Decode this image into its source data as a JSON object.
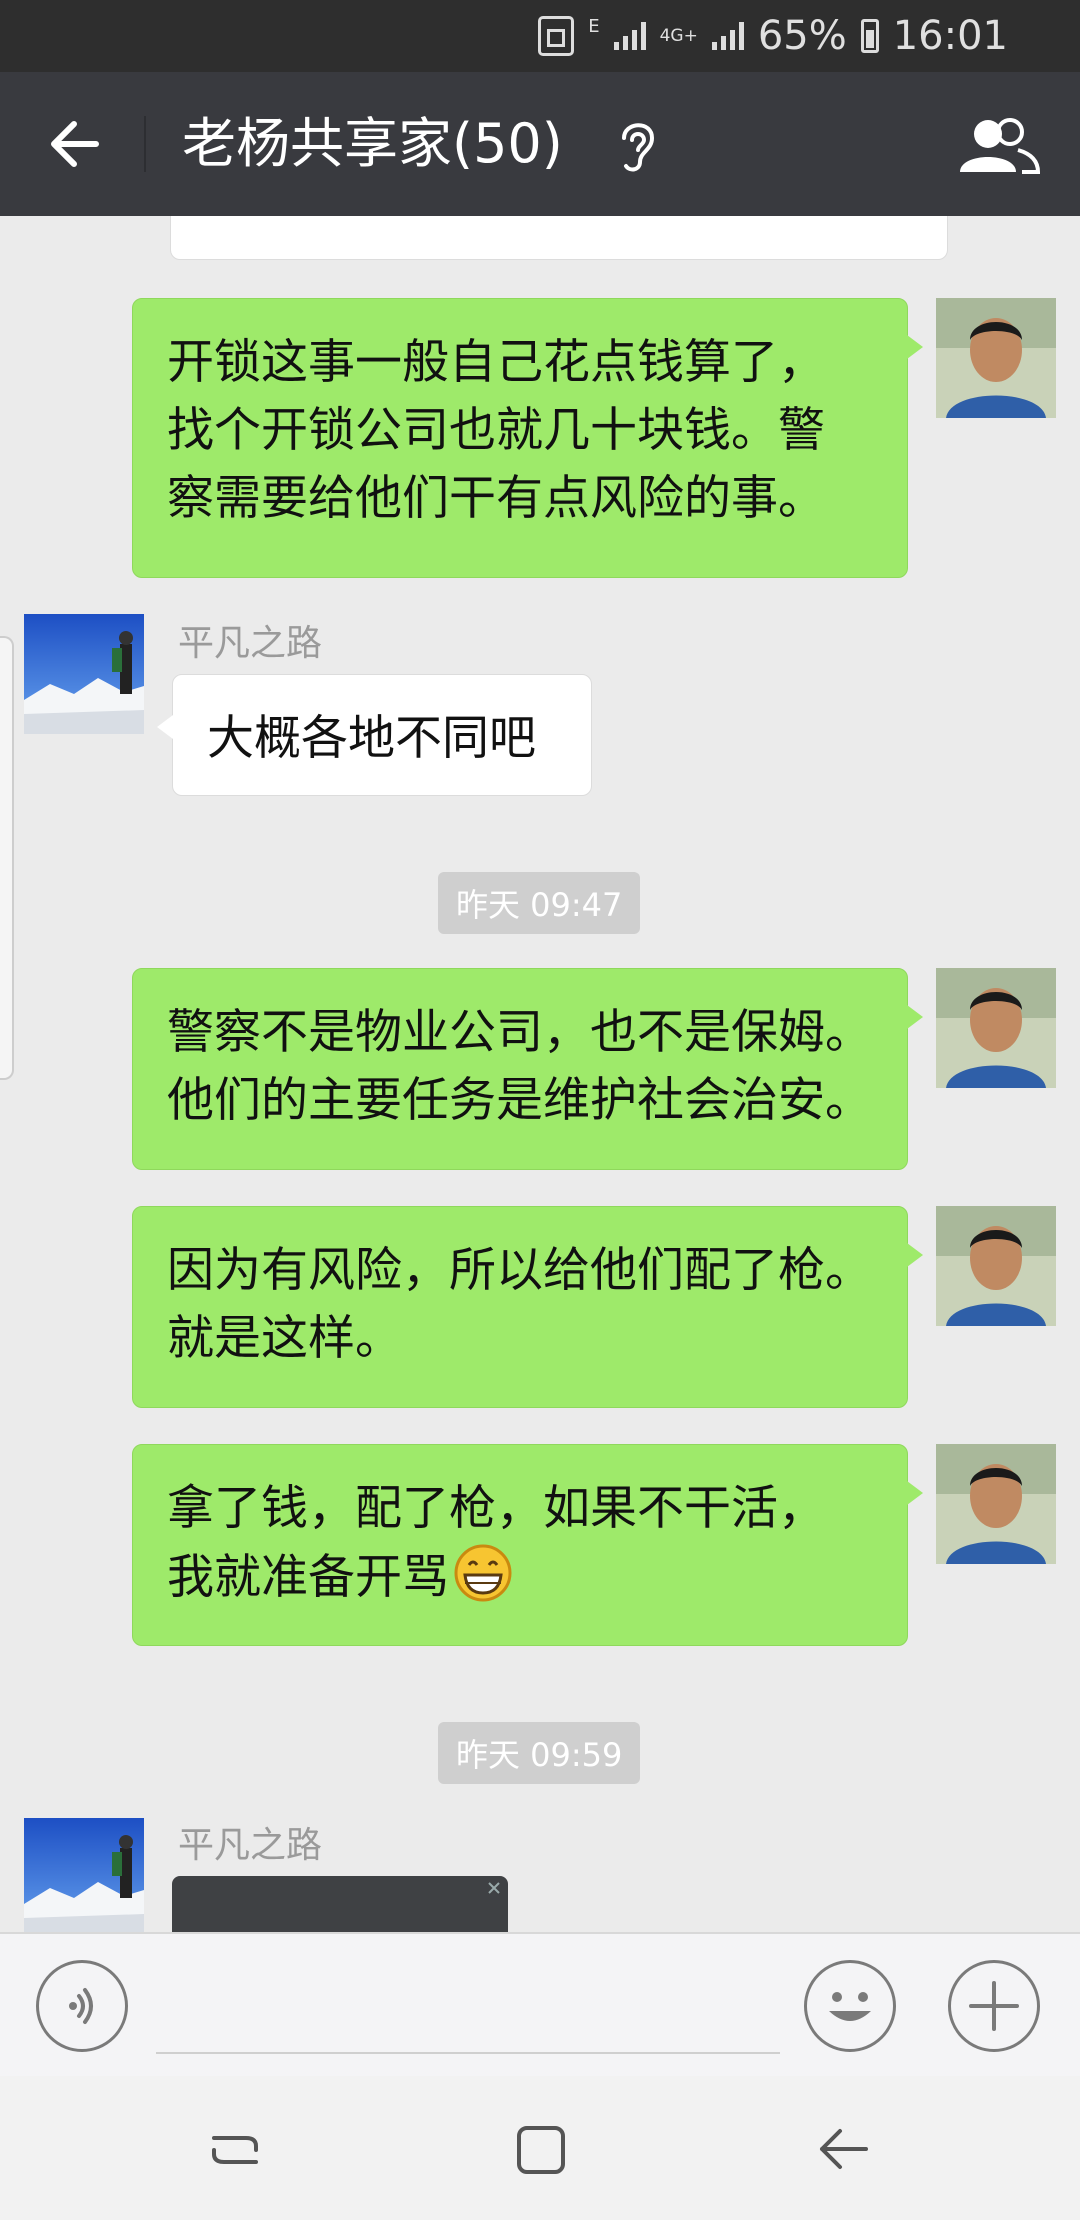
{
  "status_bar": {
    "lte_indicator": "E",
    "network_type": "4G+",
    "battery": "65%",
    "time": "16:01"
  },
  "header": {
    "title": "老杨共享家(50)",
    "icons": [
      "back-arrow-icon",
      "ear-icon",
      "group-members-icon"
    ]
  },
  "messages": [
    {
      "side": "left",
      "lines": [
        "…"
      ],
      "partial": true
    },
    {
      "side": "right",
      "lines": [
        "开锁这事一般自己花点钱算了，",
        "找个开锁公司也就几十块钱。警",
        "察需要给他们干有点风险的事。"
      ]
    },
    {
      "side": "left",
      "sender": "平凡之路",
      "lines": [
        "大概各地不同吧"
      ]
    },
    {
      "type": "time",
      "text": "昨天 09:47"
    },
    {
      "side": "right",
      "lines": [
        "警察不是物业公司，也不是保姆。",
        "他们的主要任务是维护社会治安。"
      ]
    },
    {
      "side": "right",
      "lines": [
        "因为有风险，所以给他们配了枪。",
        "就是这样。"
      ]
    },
    {
      "side": "right",
      "lines": [
        "拿了钱，配了枪，如果不干活，",
        "我就准备开骂"
      ],
      "emoji": "grin-emoji"
    },
    {
      "type": "time",
      "text": "昨天 09:59"
    },
    {
      "side": "left",
      "sender": "平凡之路",
      "card": true
    }
  ],
  "input_bar": {
    "icons": [
      "voice-icon",
      "emoji-icon",
      "plus-icon"
    ]
  },
  "nav_bar": {
    "icons": [
      "recent-apps-icon",
      "home-icon",
      "back-icon"
    ]
  }
}
